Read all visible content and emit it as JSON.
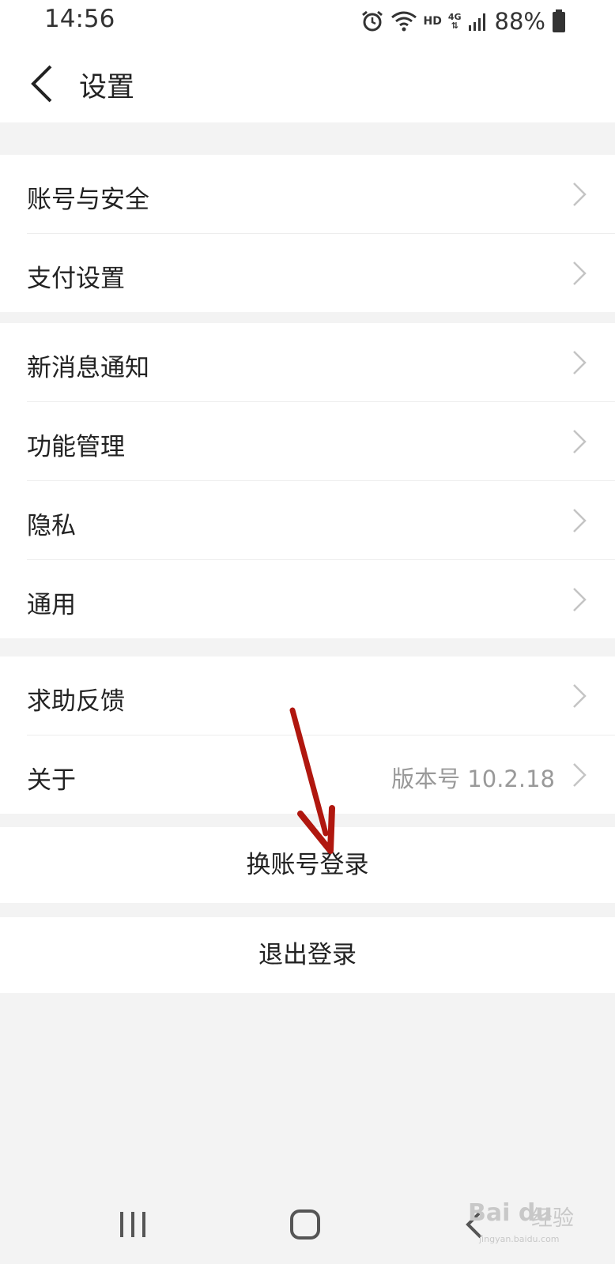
{
  "status_bar": {
    "time": "14:56",
    "hd": "HD",
    "network": "4G",
    "battery": "88%",
    "icons": [
      "alarm-icon",
      "wifi-icon",
      "signal-icon",
      "battery-icon"
    ]
  },
  "header": {
    "title": "设置",
    "back_icon": "chevron-left-icon"
  },
  "groups": [
    {
      "items": [
        {
          "label": "账号与安全"
        },
        {
          "label": "支付设置"
        }
      ]
    },
    {
      "items": [
        {
          "label": "新消息通知"
        },
        {
          "label": "功能管理"
        },
        {
          "label": "隐私"
        },
        {
          "label": "通用"
        }
      ]
    },
    {
      "items": [
        {
          "label": "求助反馈"
        },
        {
          "label": "关于",
          "value": "版本号 10.2.18"
        }
      ]
    }
  ],
  "actions": {
    "switch_account": "换账号登录",
    "logout": "退出登录"
  },
  "annotation": {
    "arrow_color": "#b0170f"
  },
  "watermark": {
    "logo": "Bai du",
    "text": "经验",
    "url": "jingyan.baidu.com"
  },
  "colors": {
    "background": "#f3f3f3",
    "surface": "#ffffff",
    "text": "#222222",
    "secondary_text": "#999999"
  }
}
